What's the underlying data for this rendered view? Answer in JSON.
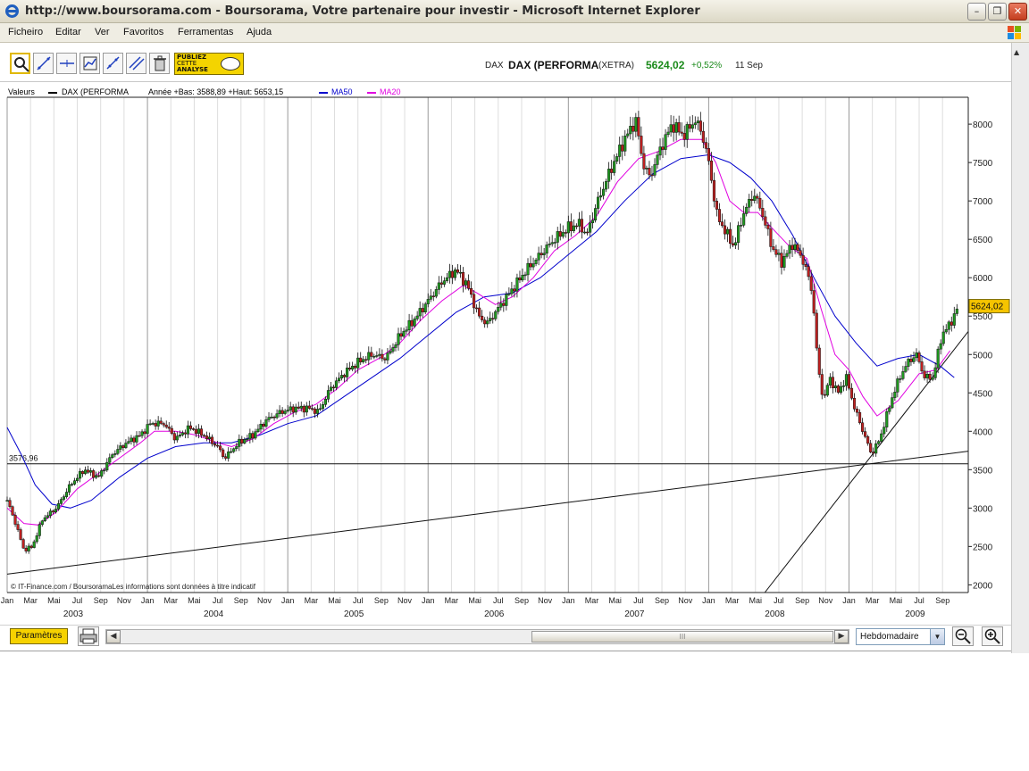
{
  "window": {
    "title": "http://www.boursorama.com - Boursorama, Votre partenaire pour investir - Microsoft Internet Explorer",
    "buttons": [
      "minimize",
      "restore",
      "close"
    ]
  },
  "menu": [
    "Ficheiro",
    "Editar",
    "Ver",
    "Favoritos",
    "Ferramentas",
    "Ajuda"
  ],
  "toolbar": {
    "tools": [
      "zoom-tool-icon",
      "trendline-tool-icon",
      "horizontal-line-tool-icon",
      "indicator-tool-icon",
      "channel-tool-icon",
      "parallel-tool-icon",
      "trash-icon"
    ],
    "publish_label": [
      "PUBLIEZ",
      "CETTE",
      "ANALYSE"
    ]
  },
  "quote": {
    "market": "DAX",
    "name": "DAX (PERFORMA",
    "exchange": "(XETRA)",
    "price": "5624,02",
    "change": "+0,52%",
    "date": "11 Sep",
    "price_color": "#1a8a1a"
  },
  "legend": {
    "label": "Valeurs",
    "series_name": "DAX (PERFORMA",
    "stats": "Année +Bas: 3588,89 +Haut: 5653,15",
    "ma50": "MA50",
    "ma20": "MA20",
    "ma50_color": "#0000cc",
    "ma20_color": "#e000e0"
  },
  "bottom": {
    "params_label": "Paramètres",
    "period": "Hebdomadaire",
    "scroll_label": "III"
  },
  "chart_data": {
    "type": "candlestick",
    "title": "",
    "credit": "© IT-Finance.com / BoursoramaLes informations sont données à titre indicatif",
    "ylim": [
      1900,
      8350
    ],
    "yticks": [
      2000,
      2500,
      3000,
      3500,
      4000,
      4500,
      5000,
      5500,
      6000,
      6500,
      7000,
      7500,
      8000
    ],
    "x_month_labels": [
      "Jan",
      "Mar",
      "Mai",
      "Jul",
      "Sep",
      "Nov",
      "Jan",
      "Mar",
      "Mai",
      "Jul",
      "Sep",
      "Nov",
      "Jan",
      "Mar",
      "Mai",
      "Jul",
      "Sep",
      "Nov",
      "Jan",
      "Mar",
      "Mai",
      "Jul",
      "Sep",
      "Nov",
      "Jan",
      "Mar",
      "Mai",
      "Jul",
      "Sep",
      "Nov",
      "Jan",
      "Mar",
      "Mai",
      "Jul",
      "Sep",
      "Nov",
      "Jan",
      "Mar",
      "Mai",
      "Jul",
      "Sep"
    ],
    "x_year_labels": [
      "2003",
      "2004",
      "2005",
      "2006",
      "2007",
      "2008",
      "2009"
    ],
    "time_range": [
      "2003-01",
      "2009-09"
    ],
    "horizontal_line": {
      "value": 3576.96,
      "label": "3576,96"
    },
    "last_price_label": {
      "value": 5624.02,
      "label": "5624,02"
    },
    "trendlines": [
      {
        "from": {
          "t": 2003.0,
          "y": 2140
        },
        "to": {
          "t": 2009.85,
          "y": 3740
        }
      },
      {
        "from": {
          "t": 2008.4,
          "y": 1900
        },
        "to": {
          "t": 2009.85,
          "y": 5300
        }
      }
    ],
    "price_path": [
      [
        2003.0,
        3100
      ],
      [
        2003.06,
        2800
      ],
      [
        2003.12,
        2450
      ],
      [
        2003.18,
        2500
      ],
      [
        2003.25,
        2850
      ],
      [
        2003.35,
        3000
      ],
      [
        2003.45,
        3300
      ],
      [
        2003.55,
        3500
      ],
      [
        2003.65,
        3400
      ],
      [
        2003.75,
        3700
      ],
      [
        2003.85,
        3850
      ],
      [
        2003.95,
        3950
      ],
      [
        2004.02,
        4100
      ],
      [
        2004.12,
        4100
      ],
      [
        2004.2,
        3900
      ],
      [
        2004.3,
        4050
      ],
      [
        2004.4,
        3950
      ],
      [
        2004.5,
        3800
      ],
      [
        2004.55,
        3650
      ],
      [
        2004.65,
        3850
      ],
      [
        2004.75,
        3950
      ],
      [
        2004.85,
        4150
      ],
      [
        2004.95,
        4250
      ],
      [
        2005.05,
        4300
      ],
      [
        2005.15,
        4300
      ],
      [
        2005.22,
        4250
      ],
      [
        2005.3,
        4550
      ],
      [
        2005.4,
        4750
      ],
      [
        2005.5,
        4900
      ],
      [
        2005.6,
        5000
      ],
      [
        2005.7,
        4950
      ],
      [
        2005.8,
        5250
      ],
      [
        2005.9,
        5450
      ],
      [
        2006.0,
        5700
      ],
      [
        2006.1,
        5950
      ],
      [
        2006.2,
        6100
      ],
      [
        2006.28,
        5900
      ],
      [
        2006.36,
        5500
      ],
      [
        2006.42,
        5400
      ],
      [
        2006.5,
        5600
      ],
      [
        2006.6,
        5850
      ],
      [
        2006.7,
        6100
      ],
      [
        2006.8,
        6300
      ],
      [
        2006.9,
        6500
      ],
      [
        2007.0,
        6650
      ],
      [
        2007.08,
        6700
      ],
      [
        2007.13,
        6550
      ],
      [
        2007.2,
        6950
      ],
      [
        2007.3,
        7400
      ],
      [
        2007.4,
        7800
      ],
      [
        2007.48,
        8050
      ],
      [
        2007.53,
        7500
      ],
      [
        2007.58,
        7300
      ],
      [
        2007.66,
        7700
      ],
      [
        2007.74,
        8000
      ],
      [
        2007.82,
        7850
      ],
      [
        2007.9,
        8050
      ],
      [
        2007.95,
        7900
      ],
      [
        2008.0,
        7500
      ],
      [
        2008.06,
        6800
      ],
      [
        2008.12,
        6600
      ],
      [
        2008.18,
        6400
      ],
      [
        2008.24,
        6800
      ],
      [
        2008.32,
        7100
      ],
      [
        2008.38,
        6850
      ],
      [
        2008.45,
        6400
      ],
      [
        2008.52,
        6200
      ],
      [
        2008.6,
        6450
      ],
      [
        2008.68,
        6200
      ],
      [
        2008.74,
        5800
      ],
      [
        2008.78,
        4800
      ],
      [
        2008.82,
        4400
      ],
      [
        2008.86,
        4700
      ],
      [
        2008.92,
        4500
      ],
      [
        2008.98,
        4700
      ],
      [
        2009.04,
        4300
      ],
      [
        2009.1,
        4000
      ],
      [
        2009.16,
        3700
      ],
      [
        2009.22,
        3900
      ],
      [
        2009.3,
        4400
      ],
      [
        2009.36,
        4700
      ],
      [
        2009.42,
        4900
      ],
      [
        2009.48,
        5000
      ],
      [
        2009.54,
        4700
      ],
      [
        2009.6,
        4700
      ],
      [
        2009.66,
        5250
      ],
      [
        2009.72,
        5400
      ],
      [
        2009.78,
        5624
      ]
    ],
    "ma20_path": [
      [
        2003.0,
        3000
      ],
      [
        2003.12,
        2800
      ],
      [
        2003.22,
        2780
      ],
      [
        2003.35,
        2950
      ],
      [
        2003.5,
        3250
      ],
      [
        2003.65,
        3450
      ],
      [
        2003.8,
        3650
      ],
      [
        2003.95,
        3850
      ],
      [
        2004.05,
        4000
      ],
      [
        2004.2,
        4000
      ],
      [
        2004.35,
        3950
      ],
      [
        2004.5,
        3850
      ],
      [
        2004.6,
        3800
      ],
      [
        2004.75,
        3900
      ],
      [
        2004.9,
        4100
      ],
      [
        2005.05,
        4250
      ],
      [
        2005.2,
        4350
      ],
      [
        2005.35,
        4550
      ],
      [
        2005.5,
        4800
      ],
      [
        2005.65,
        4950
      ],
      [
        2005.8,
        5150
      ],
      [
        2005.95,
        5450
      ],
      [
        2006.1,
        5700
      ],
      [
        2006.25,
        5900
      ],
      [
        2006.35,
        5800
      ],
      [
        2006.48,
        5650
      ],
      [
        2006.6,
        5750
      ],
      [
        2006.75,
        6000
      ],
      [
        2006.9,
        6350
      ],
      [
        2007.05,
        6550
      ],
      [
        2007.2,
        6800
      ],
      [
        2007.35,
        7250
      ],
      [
        2007.5,
        7550
      ],
      [
        2007.65,
        7650
      ],
      [
        2007.8,
        7800
      ],
      [
        2007.95,
        7800
      ],
      [
        2008.05,
        7500
      ],
      [
        2008.15,
        7000
      ],
      [
        2008.25,
        6850
      ],
      [
        2008.35,
        6850
      ],
      [
        2008.45,
        6650
      ],
      [
        2008.58,
        6400
      ],
      [
        2008.7,
        6250
      ],
      [
        2008.8,
        5600
      ],
      [
        2008.9,
        5000
      ],
      [
        2009.0,
        4800
      ],
      [
        2009.1,
        4450
      ],
      [
        2009.2,
        4200
      ],
      [
        2009.35,
        4400
      ],
      [
        2009.5,
        4750
      ],
      [
        2009.62,
        4800
      ],
      [
        2009.72,
        5050
      ]
    ],
    "ma50_path": [
      [
        2003.0,
        4050
      ],
      [
        2003.1,
        3700
      ],
      [
        2003.2,
        3300
      ],
      [
        2003.32,
        3050
      ],
      [
        2003.45,
        3000
      ],
      [
        2003.6,
        3100
      ],
      [
        2003.8,
        3400
      ],
      [
        2004.0,
        3650
      ],
      [
        2004.2,
        3800
      ],
      [
        2004.4,
        3850
      ],
      [
        2004.6,
        3850
      ],
      [
        2004.8,
        3950
      ],
      [
        2005.0,
        4100
      ],
      [
        2005.2,
        4200
      ],
      [
        2005.4,
        4450
      ],
      [
        2005.6,
        4700
      ],
      [
        2005.8,
        4950
      ],
      [
        2006.0,
        5250
      ],
      [
        2006.2,
        5550
      ],
      [
        2006.4,
        5750
      ],
      [
        2006.6,
        5800
      ],
      [
        2006.8,
        6000
      ],
      [
        2007.0,
        6300
      ],
      [
        2007.2,
        6600
      ],
      [
        2007.4,
        7000
      ],
      [
        2007.6,
        7350
      ],
      [
        2007.8,
        7550
      ],
      [
        2008.0,
        7600
      ],
      [
        2008.15,
        7500
      ],
      [
        2008.3,
        7300
      ],
      [
        2008.45,
        7000
      ],
      [
        2008.6,
        6550
      ],
      [
        2008.75,
        6000
      ],
      [
        2008.9,
        5500
      ],
      [
        2009.05,
        5150
      ],
      [
        2009.2,
        4850
      ],
      [
        2009.35,
        4950
      ],
      [
        2009.5,
        5000
      ],
      [
        2009.65,
        4850
      ],
      [
        2009.75,
        4700
      ]
    ]
  }
}
